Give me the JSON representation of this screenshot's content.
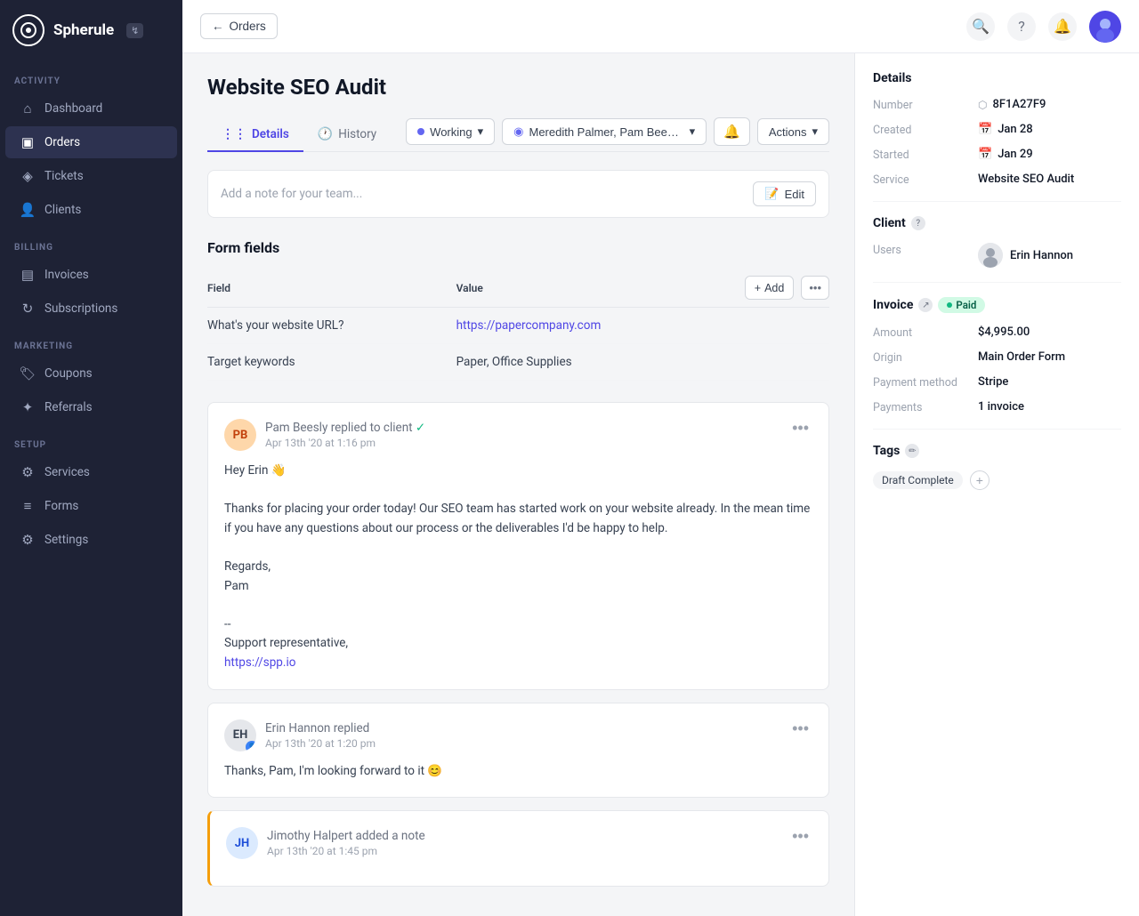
{
  "app": {
    "name": "Spherule",
    "badge": "↯"
  },
  "sidebar": {
    "activity_label": "ACTIVITY",
    "billing_label": "BILLING",
    "marketing_label": "MARKETING",
    "setup_label": "SETUP",
    "nav_items": [
      {
        "id": "dashboard",
        "label": "Dashboard",
        "icon": "⊞",
        "active": false
      },
      {
        "id": "orders",
        "label": "Orders",
        "icon": "▣",
        "active": true
      },
      {
        "id": "tickets",
        "label": "Tickets",
        "icon": "🎫",
        "active": false
      },
      {
        "id": "clients",
        "label": "Clients",
        "icon": "👥",
        "active": false
      }
    ],
    "billing_items": [
      {
        "id": "invoices",
        "label": "Invoices",
        "icon": "📄",
        "active": false
      },
      {
        "id": "subscriptions",
        "label": "Subscriptions",
        "icon": "🔄",
        "active": false
      }
    ],
    "marketing_items": [
      {
        "id": "coupons",
        "label": "Coupons",
        "icon": "🏷",
        "active": false
      },
      {
        "id": "referrals",
        "label": "Referrals",
        "icon": "✦",
        "active": false
      }
    ],
    "setup_items": [
      {
        "id": "services",
        "label": "Services",
        "icon": "⚙",
        "active": false
      },
      {
        "id": "forms",
        "label": "Forms",
        "icon": "📋",
        "active": false
      },
      {
        "id": "settings",
        "label": "Settings",
        "icon": "⚙",
        "active": false
      }
    ]
  },
  "topbar": {
    "back_label": "Orders",
    "search_placeholder": "Search"
  },
  "page": {
    "title": "Website SEO Audit",
    "tab_details": "Details",
    "tab_history": "History",
    "status": "Working",
    "assignees": "Meredith Palmer, Pam Beesly, Jimothy...",
    "actions_label": "Actions"
  },
  "note_input": {
    "placeholder": "Add a note for your team...",
    "edit_label": "Edit"
  },
  "form_fields": {
    "section_title": "Form fields",
    "field_header": "Field",
    "value_header": "Value",
    "add_label": "+ Add",
    "rows": [
      {
        "field": "What's your website URL?",
        "value": "https://papercompany.com",
        "is_link": true
      },
      {
        "field": "Target keywords",
        "value": "Paper, Office Supplies",
        "is_link": false
      }
    ]
  },
  "comments": [
    {
      "id": "pam-comment",
      "author": "Pam Beesly",
      "action": "replied to client",
      "time": "Apr 13th '20 at 1:16 pm",
      "verified": true,
      "avatar_text": "PB",
      "avatar_color": "#f97316",
      "is_client": false,
      "body_lines": [
        "Hey Erin 👋",
        "",
        "Thanks for placing your order today! Our SEO team has started work on your website already. In the mean time if you have any questions about our process or the deliverables I'd be happy to help.",
        "",
        "Regards,",
        "Pam",
        "",
        "--",
        "Support representative,",
        ""
      ],
      "link_text": "https://spp.io",
      "link_url": "https://spp.io"
    },
    {
      "id": "erin-comment",
      "author": "Erin Hannon",
      "action": "replied",
      "time": "Apr 13th '20 at 1:20 pm",
      "verified": false,
      "avatar_text": "EH",
      "avatar_color": "#6b7280",
      "is_client": true,
      "body_lines": [
        "Thanks, Pam, I'm looking forward to it 😊"
      ],
      "link_text": "",
      "link_url": ""
    },
    {
      "id": "jimothy-comment",
      "author": "Jimothy Halpert",
      "action": "added a note",
      "time": "Apr 13th '20 at 1:45 pm",
      "verified": false,
      "avatar_text": "JH",
      "avatar_color": "#3b82f6",
      "is_client": false,
      "body_lines": [],
      "link_text": "",
      "link_url": ""
    }
  ],
  "details_panel": {
    "section_title": "Details",
    "number_label": "Number",
    "number_value": "8F1A27F9",
    "created_label": "Created",
    "created_value": "Jan 28",
    "started_label": "Started",
    "started_value": "Jan 29",
    "service_label": "Service",
    "service_value": "Website SEO Audit",
    "client_label": "Client",
    "users_label": "Users",
    "user_name": "Erin Hannon",
    "invoice_label": "Invoice",
    "invoice_status": "Paid",
    "amount_label": "Amount",
    "amount_value": "$4,995.00",
    "origin_label": "Origin",
    "origin_value": "Main Order Form",
    "payment_method_label": "Payment method",
    "payment_method_value": "Stripe",
    "payments_label": "Payments",
    "payments_value": "1 invoice",
    "tags_label": "Tags",
    "tag_1": "Draft Complete",
    "add_tag_label": "+"
  }
}
